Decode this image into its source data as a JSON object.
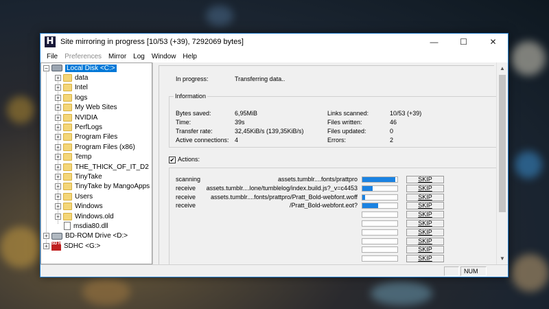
{
  "window": {
    "title": "Site mirroring in progress [10/53 (+39), 7292069 bytes]",
    "icon_letter": "H",
    "controls": [
      "minimize-icon",
      "maximize-icon",
      "close-icon"
    ]
  },
  "menu": [
    "File",
    "Preferences",
    "Mirror",
    "Log",
    "Window",
    "Help"
  ],
  "tree": {
    "root": "Local Disk <C:>",
    "folders": [
      "data",
      "Intel",
      "logs",
      "My Web Sites",
      "NVIDIA",
      "PerfLogs",
      "Program Files",
      "Program Files (x86)",
      "Temp",
      "THE_THICK_OF_IT_D2",
      "TinyTake",
      "TinyTake by MangoApps",
      "Users",
      "Windows",
      "Windows.old"
    ],
    "file": "msdia80.dll",
    "drives": [
      "BD-ROM Drive <D:>",
      "SDHC <G:>"
    ],
    "sd_icon_text": "SD HC"
  },
  "status": {
    "in_progress_label": "In progress:",
    "in_progress_value": "Transferring data.."
  },
  "information": {
    "title": "Information",
    "left": [
      {
        "label": "Bytes saved:",
        "value": "6,95MiB"
      },
      {
        "label": "Time:",
        "value": "39s"
      },
      {
        "label": "Transfer rate:",
        "value": "32,45KiB/s (139,35KiB/s)"
      },
      {
        "label": "Active connections:",
        "value": "4"
      }
    ],
    "right": [
      {
        "label": "Links scanned:",
        "value": "10/53 (+39)"
      },
      {
        "label": "Files written:",
        "value": "46"
      },
      {
        "label": "Files updated:",
        "value": "0"
      },
      {
        "label": "Errors:",
        "value": "2"
      }
    ]
  },
  "actions": {
    "label": "Actions:",
    "checked": true,
    "check_glyph": "✔",
    "skip_label": "SKIP",
    "rows": [
      {
        "action": "scanning",
        "path": "assets.tumblr....fonts/prattpro",
        "progress": 0.95
      },
      {
        "action": "receive",
        "path": "assets.tumblr....lone/tumblelog/index.build.js?_v=c4453",
        "progress": 0.3
      },
      {
        "action": "receive",
        "path": "assets.tumblr....fonts/prattpro/Pratt_Bold-webfont.woff",
        "progress": 0.08
      },
      {
        "action": "receive",
        "path": "/Pratt_Bold-webfont.eot?",
        "progress": 0.45
      },
      {
        "action": "",
        "path": "",
        "progress": 0
      },
      {
        "action": "",
        "path": "",
        "progress": 0
      },
      {
        "action": "",
        "path": "",
        "progress": 0
      },
      {
        "action": "",
        "path": "",
        "progress": 0
      },
      {
        "action": "",
        "path": "",
        "progress": 0
      },
      {
        "action": "",
        "path": "",
        "progress": 0
      }
    ]
  },
  "statusbar": {
    "num": "NUM"
  },
  "colors": {
    "accent": "#0078d7",
    "progress_fill": "#1a82e2",
    "folder": "#f4d678"
  }
}
